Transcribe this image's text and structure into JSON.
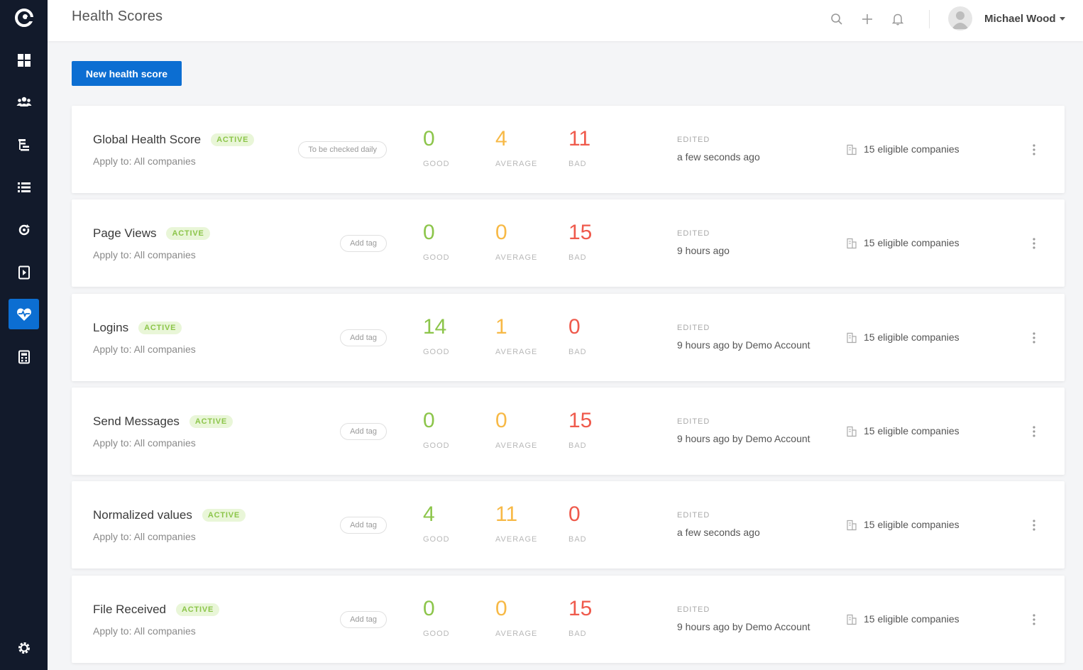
{
  "header": {
    "title": "Health Scores",
    "user_name": "Michael Wood",
    "icons": [
      "search-icon",
      "plus-icon",
      "bell-icon"
    ]
  },
  "toolbar": {
    "new_button_label": "New health score"
  },
  "sidebar": {
    "items": [
      {
        "icon": "logo-icon"
      },
      {
        "icon": "dashboard-icon"
      },
      {
        "icon": "users-icon"
      },
      {
        "icon": "segments-icon"
      },
      {
        "icon": "list-icon"
      },
      {
        "icon": "refresh-icon"
      },
      {
        "icon": "playbook-icon"
      },
      {
        "icon": "health-icon",
        "active": true
      },
      {
        "icon": "calculator-icon"
      },
      {
        "icon": "settings-icon"
      }
    ]
  },
  "labels": {
    "good": "GOOD",
    "average": "AVERAGE",
    "bad": "BAD",
    "edited": "EDITED"
  },
  "colors": {
    "accent": "#0c6ed2",
    "sidebar": "#121a2b",
    "good": "#8cc54a",
    "average": "#f7b946",
    "bad": "#ef5a4c"
  },
  "scores": [
    {
      "name": "Global Health Score",
      "status": "ACTIVE",
      "apply": "Apply to: All companies",
      "tag": "To be checked daily",
      "good": "0",
      "average": "4",
      "bad": "11",
      "edited": "a few seconds ago",
      "companies": "15 eligible companies"
    },
    {
      "name": "Page Views",
      "status": "ACTIVE",
      "apply": "Apply to: All companies",
      "tag": "Add tag",
      "good": "0",
      "average": "0",
      "bad": "15",
      "edited": "9 hours ago",
      "companies": "15 eligible companies"
    },
    {
      "name": "Logins",
      "status": "ACTIVE",
      "apply": "Apply to: All companies",
      "tag": "Add tag",
      "good": "14",
      "average": "1",
      "bad": "0",
      "edited": "9 hours ago by Demo Account",
      "companies": "15 eligible companies"
    },
    {
      "name": "Send Messages",
      "status": "ACTIVE",
      "apply": "Apply to: All companies",
      "tag": "Add tag",
      "good": "0",
      "average": "0",
      "bad": "15",
      "edited": "9 hours ago by Demo Account",
      "companies": "15 eligible companies"
    },
    {
      "name": "Normalized values",
      "status": "ACTIVE",
      "apply": "Apply to: All companies",
      "tag": "Add tag",
      "good": "4",
      "average": "11",
      "bad": "0",
      "edited": "a few seconds ago",
      "companies": "15 eligible companies"
    },
    {
      "name": "File Received",
      "status": "ACTIVE",
      "apply": "Apply to: All companies",
      "tag": "Add tag",
      "good": "0",
      "average": "0",
      "bad": "15",
      "edited": "9 hours ago by Demo Account",
      "companies": "15 eligible companies"
    }
  ]
}
